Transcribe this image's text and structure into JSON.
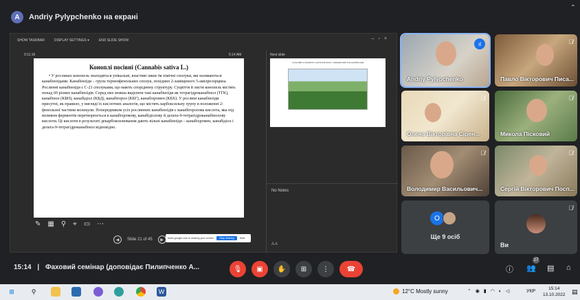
{
  "presenter": {
    "initial": "A",
    "label": "Andriy Pylypchenko на екрані"
  },
  "ppt": {
    "toolbar": [
      "SHOW TASKBAR",
      "DISPLAY SETTINGS ▾",
      "END SLIDE SHOW"
    ],
    "timer": "0:11:16",
    "clock": "5:14 AM",
    "next_label": "Next slide",
    "notes_label": "No Notes",
    "slide_counter": "Slide 21 of 45",
    "slide": {
      "title": "Коноплі посівні (Cannabis sativa L.)",
      "body": "• У рослинах конопель знаходяться унікальні, властиві лише їм хімічні сполуки, які називаються канабіноїдами. Канабіноїди – група терпенфенольних сполук, похідних 2-заміщеного 5-амілрезорцина. Рослинні канабіноїди є С-21 сполуками, що мають споріднену структуру. Суцвіття й листя конопель містять понад 60 різних канабіноїдів. Серед них можна виділити такі канабіноїди як тетрагідроканабінол (ТГК), канабінол (КБН), канабідіол (КБД), канабігерол (КБГ), канабіхромен (КБХ). У рослині канабіноїди присутні, як правило, у вигляді їх кислотних аналогів, що містять карбоксильну групу в положенні 2-фенольної частини молекули. Попередником усіх рослинних канабіноїдів є канабігеролова кислота, яка під впливом ферментів перетворюється в канабіхромову, канабідіолову й дельта-9-тетрагідроканабінолову кислоти. Ці кислоти в результаті декарбоксилювання дають вільні канабіноїди – канабіхромен, канабідіол і дельта-9-тетрагідроканабінол відповідно."
    },
    "next_slide_caption": "Сучасний асортимент сортів конопель з низьким вмістом канабіноїдів",
    "share_popup": {
      "text": "meet.google.com is sharing your screen",
      "stop": "Stop sharing",
      "hide": "Hide"
    }
  },
  "participants": [
    {
      "name": "Andriy Pylypchenko",
      "active": true
    },
    {
      "name": "Павло Вікторович Писа..."
    },
    {
      "name": "Олена Вікторівна Сірен..."
    },
    {
      "name": "Микола Пісковий"
    },
    {
      "name": "Володимир Васильович..."
    },
    {
      "name": "Сергій Вікторович Посп..."
    }
  ],
  "more": {
    "initial": "O",
    "label": "Ще 9 осіб"
  },
  "you": {
    "label": "Ви"
  },
  "meeting": {
    "time": "15:14",
    "separator": "|",
    "title": "Фаховий семінар (доповідає Пилипченко А..."
  },
  "participant_count": "17",
  "taskbar": {
    "weather": "12°C  Mostly sunny",
    "lang": "УКР",
    "time": "15:14",
    "date": "13.10.2022"
  }
}
